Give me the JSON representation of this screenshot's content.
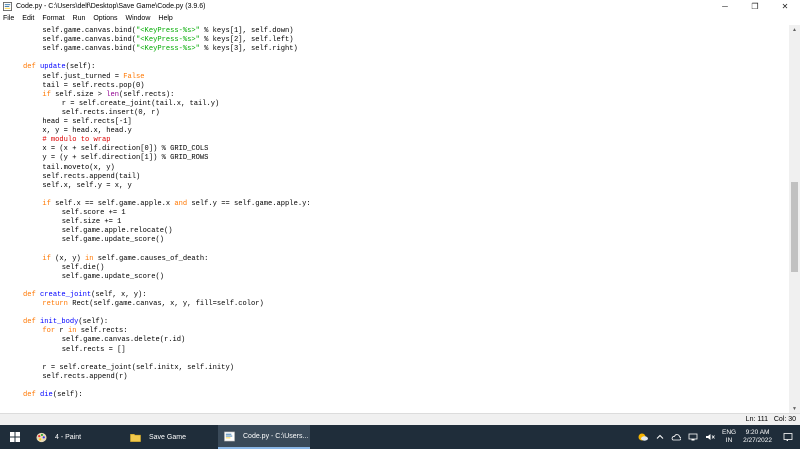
{
  "window": {
    "title": "Code.py - C:\\Users\\delf\\Desktop\\Save Game\\Code.py (3.9.6)",
    "controls": {
      "minimize": "─",
      "maximize": "❐",
      "close": "✕"
    }
  },
  "menu": [
    "File",
    "Edit",
    "Format",
    "Run",
    "Options",
    "Window",
    "Help"
  ],
  "code": [
    {
      "indent": 8,
      "segments": [
        {
          "t": "self.game.canvas.bind(",
          "c": ""
        },
        {
          "t": "\"<KeyPress-%s>\"",
          "c": "str"
        },
        {
          "t": " % keys[1], self.down)",
          "c": ""
        }
      ]
    },
    {
      "indent": 8,
      "segments": [
        {
          "t": "self.game.canvas.bind(",
          "c": ""
        },
        {
          "t": "\"<KeyPress-%s>\"",
          "c": "str"
        },
        {
          "t": " % keys[2], self.left)",
          "c": ""
        }
      ]
    },
    {
      "indent": 8,
      "segments": [
        {
          "t": "self.game.canvas.bind(",
          "c": ""
        },
        {
          "t": "\"<KeyPress-%s>\"",
          "c": "str"
        },
        {
          "t": " % keys[3], self.right)",
          "c": ""
        }
      ]
    },
    {
      "indent": 0,
      "segments": []
    },
    {
      "indent": 4,
      "segments": [
        {
          "t": "def",
          "c": "kw"
        },
        {
          "t": " ",
          "c": ""
        },
        {
          "t": "update",
          "c": "def"
        },
        {
          "t": "(self):",
          "c": ""
        }
      ]
    },
    {
      "indent": 8,
      "segments": [
        {
          "t": "self.just_turned = ",
          "c": ""
        },
        {
          "t": "False",
          "c": "kw"
        }
      ]
    },
    {
      "indent": 8,
      "segments": [
        {
          "t": "tail = self.rects.pop(0)",
          "c": ""
        }
      ]
    },
    {
      "indent": 8,
      "segments": [
        {
          "t": "if",
          "c": "kw"
        },
        {
          "t": " self.size > ",
          "c": ""
        },
        {
          "t": "len",
          "c": "bi"
        },
        {
          "t": "(self.rects):",
          "c": ""
        }
      ]
    },
    {
      "indent": 12,
      "segments": [
        {
          "t": "r = self.create_joint(tail.x, tail.y)",
          "c": ""
        }
      ]
    },
    {
      "indent": 12,
      "segments": [
        {
          "t": "self.rects.insert(0, r)",
          "c": ""
        }
      ]
    },
    {
      "indent": 8,
      "segments": [
        {
          "t": "head = self.rects[-1]",
          "c": ""
        }
      ]
    },
    {
      "indent": 8,
      "segments": [
        {
          "t": "x, y = head.x, head.y",
          "c": ""
        }
      ]
    },
    {
      "indent": 8,
      "segments": [
        {
          "t": "# modulo to wrap",
          "c": "cm"
        }
      ]
    },
    {
      "indent": 8,
      "segments": [
        {
          "t": "x = (x + self.direction[0]) % GRID_COLS",
          "c": ""
        }
      ]
    },
    {
      "indent": 8,
      "segments": [
        {
          "t": "y = (y + self.direction[1]) % GRID_ROWS",
          "c": ""
        }
      ]
    },
    {
      "indent": 8,
      "segments": [
        {
          "t": "tail.moveto(x, y)",
          "c": ""
        }
      ]
    },
    {
      "indent": 8,
      "segments": [
        {
          "t": "self.rects.append(tail)",
          "c": ""
        }
      ]
    },
    {
      "indent": 8,
      "segments": [
        {
          "t": "self.x, self.y = x, y",
          "c": ""
        }
      ]
    },
    {
      "indent": 0,
      "segments": []
    },
    {
      "indent": 8,
      "segments": [
        {
          "t": "if",
          "c": "kw"
        },
        {
          "t": " self.x == self.game.apple.x ",
          "c": ""
        },
        {
          "t": "and",
          "c": "kw"
        },
        {
          "t": " self.y == self.game.apple.y:",
          "c": ""
        }
      ]
    },
    {
      "indent": 12,
      "segments": [
        {
          "t": "self.score += 1",
          "c": ""
        }
      ]
    },
    {
      "indent": 12,
      "segments": [
        {
          "t": "self.size += 1",
          "c": ""
        }
      ]
    },
    {
      "indent": 12,
      "segments": [
        {
          "t": "self.game.apple.relocate()",
          "c": ""
        }
      ]
    },
    {
      "indent": 12,
      "segments": [
        {
          "t": "self.game.update_score()",
          "c": ""
        }
      ]
    },
    {
      "indent": 0,
      "segments": []
    },
    {
      "indent": 8,
      "segments": [
        {
          "t": "if",
          "c": "kw"
        },
        {
          "t": " (x, y) ",
          "c": ""
        },
        {
          "t": "in",
          "c": "kw"
        },
        {
          "t": " self.game.causes_of_death:",
          "c": ""
        }
      ]
    },
    {
      "indent": 12,
      "segments": [
        {
          "t": "self.die()",
          "c": ""
        }
      ]
    },
    {
      "indent": 12,
      "segments": [
        {
          "t": "self.game.update_score()",
          "c": ""
        }
      ]
    },
    {
      "indent": 0,
      "segments": []
    },
    {
      "indent": 4,
      "segments": [
        {
          "t": "def",
          "c": "kw"
        },
        {
          "t": " ",
          "c": ""
        },
        {
          "t": "create_joint",
          "c": "def"
        },
        {
          "t": "(self, x, y):",
          "c": ""
        }
      ]
    },
    {
      "indent": 8,
      "segments": [
        {
          "t": "return",
          "c": "kw"
        },
        {
          "t": " Rect(self.game.canvas, x, y, fill=self.color)",
          "c": ""
        }
      ]
    },
    {
      "indent": 0,
      "segments": []
    },
    {
      "indent": 4,
      "segments": [
        {
          "t": "def",
          "c": "kw"
        },
        {
          "t": " ",
          "c": ""
        },
        {
          "t": "init_body",
          "c": "def"
        },
        {
          "t": "(self):",
          "c": ""
        }
      ]
    },
    {
      "indent": 8,
      "segments": [
        {
          "t": "for",
          "c": "kw"
        },
        {
          "t": " r ",
          "c": ""
        },
        {
          "t": "in",
          "c": "kw"
        },
        {
          "t": " self.rects:",
          "c": ""
        }
      ]
    },
    {
      "indent": 12,
      "segments": [
        {
          "t": "self.game.canvas.delete(r.id)",
          "c": ""
        }
      ]
    },
    {
      "indent": 12,
      "segments": [
        {
          "t": "self.rects = []",
          "c": ""
        }
      ]
    },
    {
      "indent": 0,
      "segments": []
    },
    {
      "indent": 8,
      "segments": [
        {
          "t": "r = self.create_joint(self.initx, self.inity)",
          "c": ""
        }
      ]
    },
    {
      "indent": 8,
      "segments": [
        {
          "t": "self.rects.append(r)",
          "c": ""
        }
      ]
    },
    {
      "indent": 0,
      "segments": []
    },
    {
      "indent": 4,
      "segments": [
        {
          "t": "def",
          "c": "kw"
        },
        {
          "t": " ",
          "c": ""
        },
        {
          "t": "die",
          "c": "def"
        },
        {
          "t": "(self):",
          "c": ""
        }
      ]
    }
  ],
  "status": {
    "line": "Ln: 111",
    "col": "Col: 30"
  },
  "taskbar": {
    "items": [
      {
        "label": "4 - Paint",
        "icon": "paint-icon"
      },
      {
        "label": "Save Game",
        "icon": "folder-icon"
      },
      {
        "label": "Code.py - C:\\Users...",
        "icon": "python-idle-icon"
      }
    ],
    "tray": {
      "lang_top": "ENG",
      "lang_bottom": "IN",
      "time": "9:20 AM",
      "date": "2/27/2022"
    }
  },
  "colors": {
    "keyword": "#ff7700",
    "definition": "#0000ff",
    "string": "#00aa00",
    "builtin": "#900090",
    "comment": "#dd0000",
    "taskbar": "#1f2d3a"
  }
}
